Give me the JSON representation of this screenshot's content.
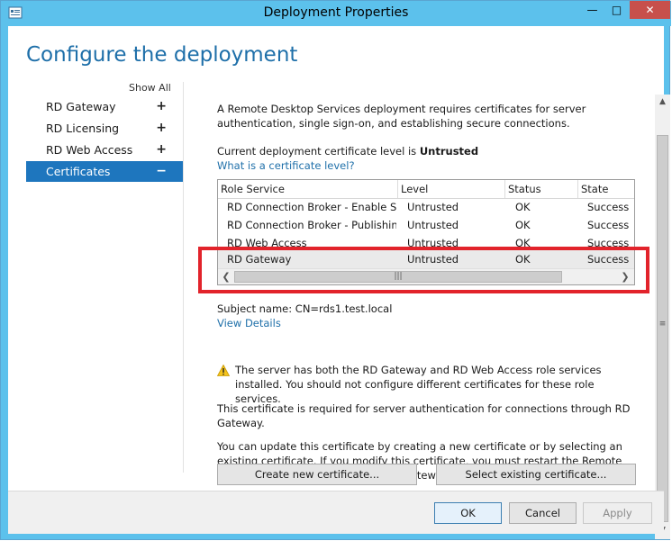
{
  "window": {
    "title": "Deployment Properties",
    "controls": {
      "minimize": "—",
      "maximize": "□",
      "close": "✕"
    }
  },
  "heading": "Configure the deployment",
  "nav": {
    "show_all": "Show All",
    "items": [
      {
        "label": "RD Gateway",
        "expander": "+"
      },
      {
        "label": "RD Licensing",
        "expander": "+"
      },
      {
        "label": "RD Web Access",
        "expander": "+"
      },
      {
        "label": "Certificates",
        "expander": "−"
      }
    ],
    "selected": "Certificates"
  },
  "content": {
    "intro": "A Remote Desktop Services deployment requires certificates for server authentication, single sign-on, and establishing secure connections.",
    "level_prefix": "Current deployment certificate level is ",
    "level_value": "Untrusted",
    "level_link": "What is a certificate level?",
    "table": {
      "columns": [
        "Role Service",
        "Level",
        "Status",
        "State"
      ],
      "rows": [
        {
          "role": "RD Connection Broker - Enable Single Sign On",
          "level": "Untrusted",
          "status": "OK",
          "state": "Success"
        },
        {
          "role": "RD Connection Broker - Publishing",
          "level": "Untrusted",
          "status": "OK",
          "state": "Success"
        },
        {
          "role": "RD Web Access",
          "level": "Untrusted",
          "status": "OK",
          "state": "Success"
        },
        {
          "role": "RD Gateway",
          "level": "Untrusted",
          "status": "OK",
          "state": "Success"
        }
      ],
      "selected_row": "RD Gateway"
    },
    "subject_name": "Subject name: CN=rds1.test.local",
    "view_details": "View Details",
    "warning": "The server has both the RD Gateway and RD Web Access role services installed. You should not configure different certificates for these role services.",
    "required_text": "This certificate is required for server authentication for connections through RD Gateway.",
    "update_text": "You can update this certificate by creating a new certificate or by selecting an existing certificate. If you modify this certificate, you must restart the Remote Desktop Gateway service on all RD Gateway servers.",
    "create_button": "Create new certificate...",
    "select_button": "Select existing certificate..."
  },
  "footer": {
    "ok": "OK",
    "cancel": "Cancel",
    "apply": "Apply"
  },
  "colors": {
    "titlebar": "#5cc1ec",
    "accent": "#1e76be",
    "heading": "#1e6fa9",
    "highlight_box": "#e2232b"
  }
}
